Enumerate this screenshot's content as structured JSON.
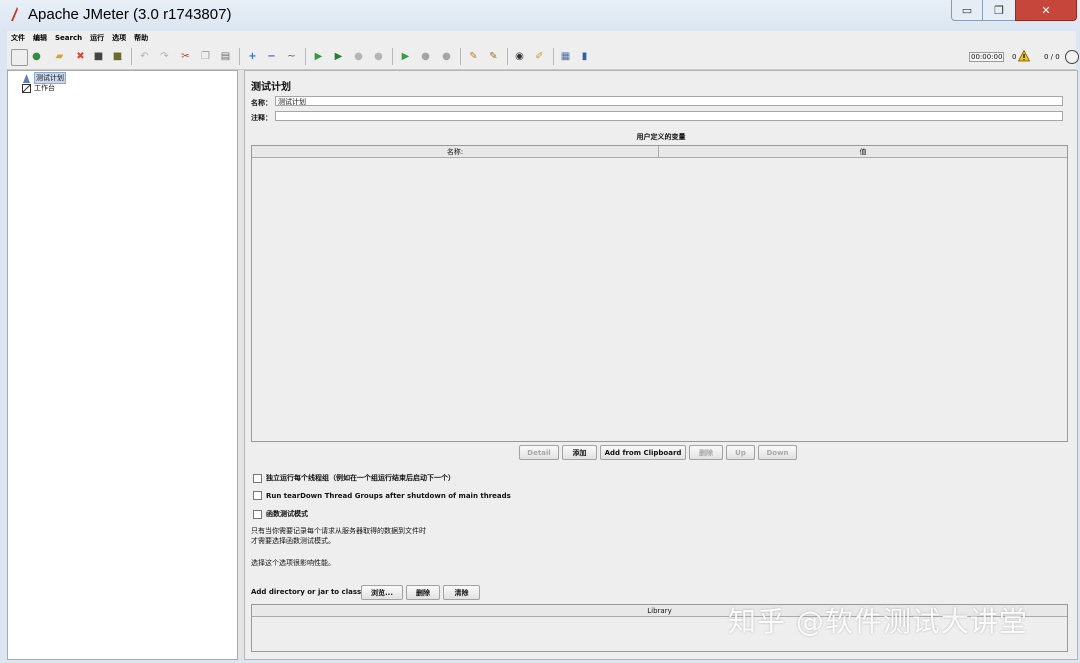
{
  "window": {
    "title": "Apache JMeter (3.0 r1743807)",
    "minimize_glyph": "▭",
    "maximize_glyph": "❐",
    "close_glyph": "✕"
  },
  "menu": [
    "文件",
    "编辑",
    "Search",
    "运行",
    "选项",
    "帮助"
  ],
  "toolbar": {
    "icons": [
      {
        "name": "new-icon",
        "glyph": "",
        "color": "#f4f4f4"
      },
      {
        "name": "templates-icon",
        "glyph": "●",
        "color": "#2f8f3f"
      },
      {
        "name": "open-icon",
        "glyph": "▰",
        "color": "#d8a23a"
      },
      {
        "name": "close-plan-icon",
        "glyph": "✖",
        "color": "#d24a3a"
      },
      {
        "name": "save-icon",
        "glyph": "■",
        "color": "#444444"
      },
      {
        "name": "save-as-icon",
        "glyph": "■",
        "color": "#6a6a30"
      },
      {
        "name": "undo-icon",
        "glyph": "↶",
        "color": "#b0b0b0"
      },
      {
        "name": "redo-icon",
        "glyph": "↷",
        "color": "#b0b0b0"
      },
      {
        "name": "cut-icon",
        "glyph": "✂",
        "color": "#c0392b"
      },
      {
        "name": "copy-icon",
        "glyph": "❐",
        "color": "#9a9a9a"
      },
      {
        "name": "paste-icon",
        "glyph": "▤",
        "color": "#6a6a6a"
      },
      {
        "name": "expand-icon",
        "glyph": "+",
        "color": "#2f6fd0"
      },
      {
        "name": "collapse-icon",
        "glyph": "−",
        "color": "#2f6fd0"
      },
      {
        "name": "toggle-icon",
        "glyph": "~",
        "color": "#5a5a5a"
      },
      {
        "name": "start-icon",
        "glyph": "▶",
        "color": "#2e9e3c"
      },
      {
        "name": "start-no-pauses-icon",
        "glyph": "▶",
        "color": "#267f32"
      },
      {
        "name": "stop-icon",
        "glyph": "●",
        "color": "#b5b5b5"
      },
      {
        "name": "shutdown-icon",
        "glyph": "●",
        "color": "#b5b5b5"
      },
      {
        "name": "remote-start-icon",
        "glyph": "▶",
        "color": "#3a9a48"
      },
      {
        "name": "remote-stop-icon",
        "glyph": "●",
        "color": "#a5a5a5"
      },
      {
        "name": "remote-shutdown-icon",
        "glyph": "●",
        "color": "#a5a5a5"
      },
      {
        "name": "clear-icon",
        "glyph": "✎",
        "color": "#b9812f"
      },
      {
        "name": "clear-all-icon",
        "glyph": "✎",
        "color": "#a0702a"
      },
      {
        "name": "search-icon",
        "glyph": "◉",
        "color": "#333333"
      },
      {
        "name": "reset-search-icon",
        "glyph": "✐",
        "color": "#d59a2c"
      },
      {
        "name": "function-helper-icon",
        "glyph": "▦",
        "color": "#4a6fa5"
      },
      {
        "name": "help-icon",
        "glyph": "▮",
        "color": "#2f5fb0"
      }
    ],
    "timer": "00:00:00",
    "warning_count": "0",
    "threads": "0 / 0"
  },
  "tree": {
    "items": [
      {
        "label": "测试计划",
        "selected": true
      },
      {
        "label": "工作台",
        "selected": false
      }
    ]
  },
  "panel": {
    "title": "测试计划",
    "name_label": "名称：",
    "name_value": "测试计划",
    "comment_label": "注释：",
    "comment_value": "",
    "variables_title": "用户定义的变量",
    "columns": [
      "名称:",
      "值"
    ],
    "buttons": [
      {
        "label": "Detail",
        "enabled": false
      },
      {
        "label": "添加",
        "enabled": true
      },
      {
        "label": "Add from Clipboard",
        "enabled": true
      },
      {
        "label": "删除",
        "enabled": false
      },
      {
        "label": "Up",
        "enabled": false
      },
      {
        "label": "Down",
        "enabled": false
      }
    ],
    "checkboxes": [
      "独立运行每个线程组（例如在一个组运行结束后启动下一个）",
      "Run tearDown Thread Groups after shutdown of main threads",
      "函数测试模式"
    ],
    "functional_note_1": "只有当你需要记录每个请求从服务器取得的数据到文件时",
    "functional_note_2": "才需要选择函数测试模式。",
    "performance_note": "选择这个选项很影响性能。",
    "classpath_label": "Add directory or jar to classpath",
    "classpath_buttons": [
      "浏览...",
      "删除",
      "清除"
    ],
    "library_header": "Library"
  },
  "watermark": "知乎 @软件测试大讲堂"
}
